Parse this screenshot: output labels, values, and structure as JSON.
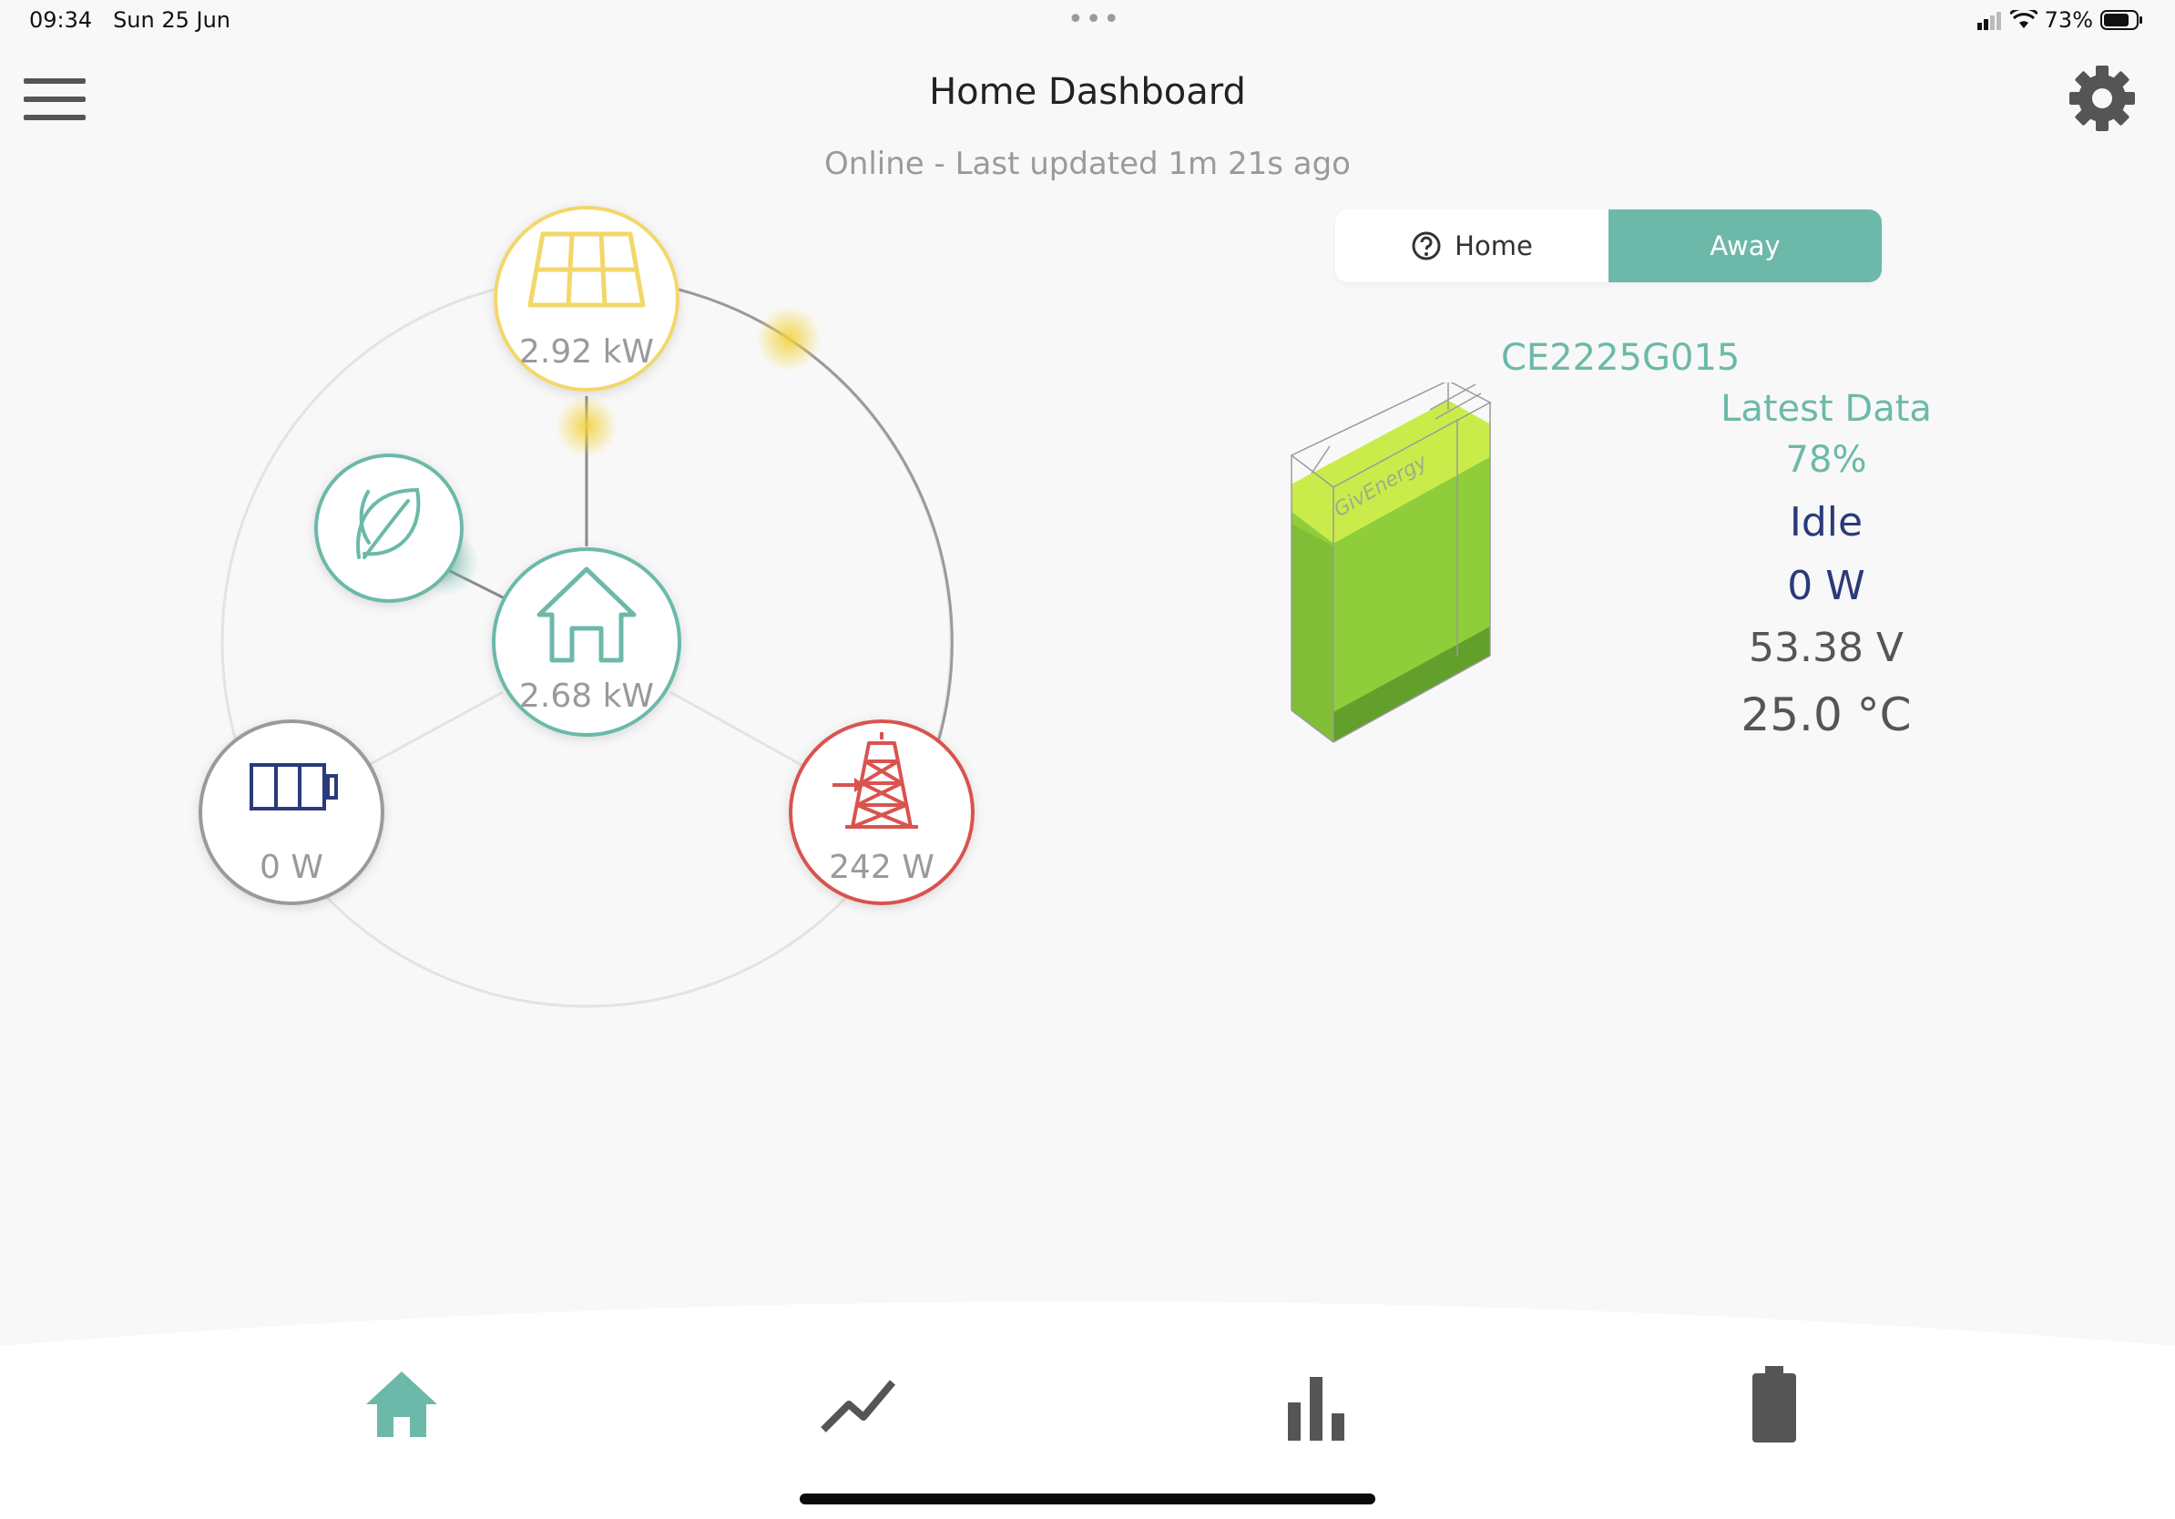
{
  "status_bar": {
    "time": "09:34",
    "date": "Sun 25 Jun",
    "battery_percent": "73%"
  },
  "header": {
    "title": "Home Dashboard",
    "subtitle": "Online - Last updated 1m 21s ago"
  },
  "mode_toggle": {
    "home_label": "Home",
    "away_label": "Away",
    "selected": "Away"
  },
  "flow": {
    "solar": {
      "value": "2.92 kW",
      "icon": "solar-panel-icon",
      "color": "#f2d76a"
    },
    "home": {
      "value": "2.68 kW",
      "icon": "house-icon",
      "color": "#6cb9a9"
    },
    "battery": {
      "value": "0 W",
      "icon": "battery-icon",
      "color": "#2b3a7a"
    },
    "grid": {
      "value": "242 W",
      "icon": "pylon-icon",
      "color": "#d9534f"
    },
    "eco": {
      "icon": "leaf-icon",
      "color": "#6cb9a9"
    }
  },
  "battery_panel": {
    "serial": "CE2225G015",
    "brand": "GivEnergy",
    "latest_label": "Latest Data",
    "soc": "78%",
    "soc_fraction": 0.78,
    "state": "Idle",
    "power": "0 W",
    "voltage": "53.38 V",
    "temperature": "25.0 °C"
  },
  "tabs": [
    {
      "name": "home",
      "icon": "home-icon",
      "active": true
    },
    {
      "name": "graphs",
      "icon": "line-chart-icon",
      "active": false
    },
    {
      "name": "stats",
      "icon": "bar-chart-icon",
      "active": false
    },
    {
      "name": "battery",
      "icon": "battery-tab-icon",
      "active": false
    }
  ],
  "colors": {
    "accent": "#6cb9a9",
    "solar": "#f2d76a",
    "grid": "#d9534f",
    "battery_dark": "#2b3a7a",
    "battery_fill": "#8fce3a"
  }
}
